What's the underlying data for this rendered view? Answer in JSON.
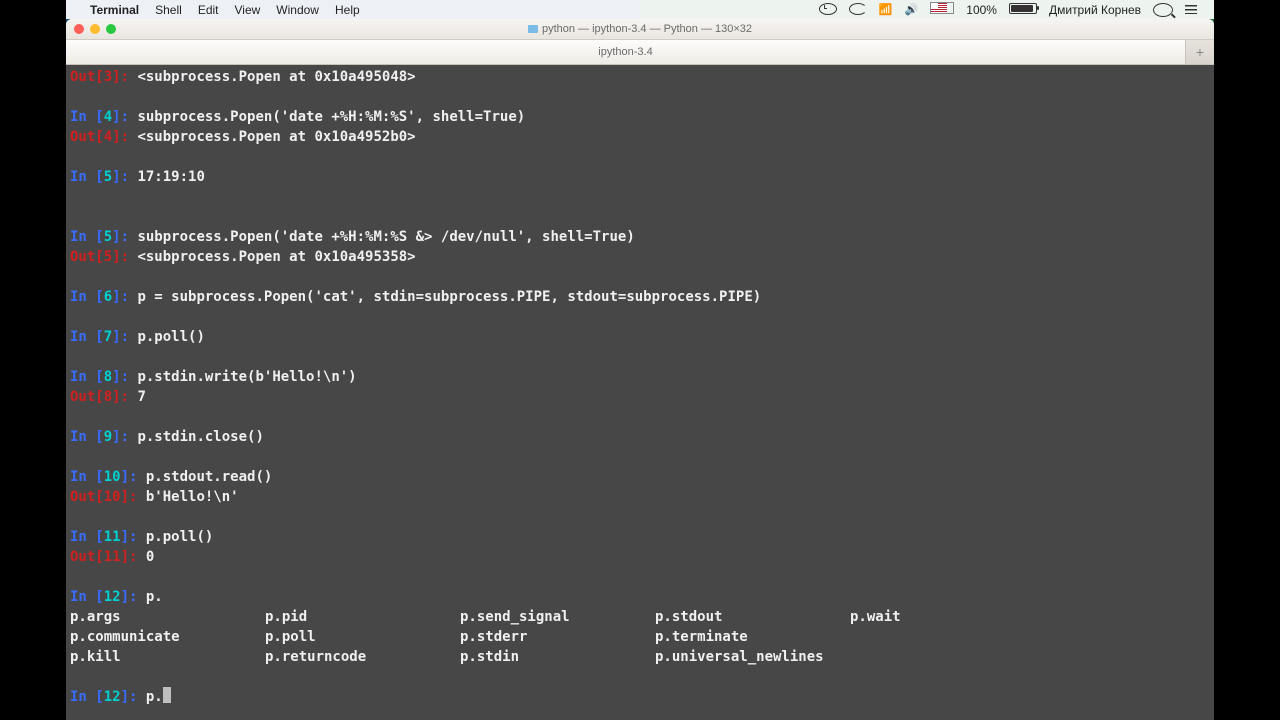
{
  "menubar": {
    "app": "Terminal",
    "items": [
      "Shell",
      "Edit",
      "View",
      "Window",
      "Help"
    ],
    "battery_pct": "100%",
    "battery_state": "⚡",
    "username": "Дмитрий Корнев"
  },
  "window": {
    "title": "python — ipython-3.4 — Python — 130×32",
    "tab": "ipython-3.4"
  },
  "lines": [
    {
      "out_n": 3,
      "out": "<subprocess.Popen at 0x10a495048>"
    },
    {
      "blank": true
    },
    {
      "in_n": 4,
      "in": "subprocess.Popen('date +%H:%M:%S', shell=True)"
    },
    {
      "out_n": 4,
      "out": "<subprocess.Popen at 0x10a4952b0>"
    },
    {
      "blank": true
    },
    {
      "in_n": 5,
      "in": "17:19:10"
    },
    {
      "blank": true
    },
    {
      "blank": true
    },
    {
      "in_n": 5,
      "in": "subprocess.Popen('date +%H:%M:%S &> /dev/null', shell=True)"
    },
    {
      "out_n": 5,
      "out": "<subprocess.Popen at 0x10a495358>"
    },
    {
      "blank": true
    },
    {
      "in_n": 6,
      "in": "p = subprocess.Popen('cat', stdin=subprocess.PIPE, stdout=subprocess.PIPE)"
    },
    {
      "blank": true
    },
    {
      "in_n": 7,
      "in": "p.poll()"
    },
    {
      "blank": true
    },
    {
      "in_n": 8,
      "in": "p.stdin.write(b'Hello!\\n')"
    },
    {
      "out_n": 8,
      "out": "7"
    },
    {
      "blank": true
    },
    {
      "in_n": 9,
      "in": "p.stdin.close()"
    },
    {
      "blank": true
    },
    {
      "in_n": 10,
      "in": "p.stdout.read()"
    },
    {
      "out_n": 10,
      "out": "b'Hello!\\n'"
    },
    {
      "blank": true
    },
    {
      "in_n": 11,
      "in": "p.poll()"
    },
    {
      "out_n": 11,
      "out": "0"
    },
    {
      "blank": true
    },
    {
      "in_n": 12,
      "in": "p."
    }
  ],
  "completions": [
    [
      "p.args",
      "p.pid",
      "p.send_signal",
      "p.stdout",
      "p.wait"
    ],
    [
      "p.communicate",
      "p.poll",
      "p.stderr",
      "p.terminate",
      ""
    ],
    [
      "p.kill",
      "p.returncode",
      "p.stdin",
      "p.universal_newlines",
      ""
    ]
  ],
  "current_prompt": {
    "n": 12,
    "typed": "p."
  }
}
